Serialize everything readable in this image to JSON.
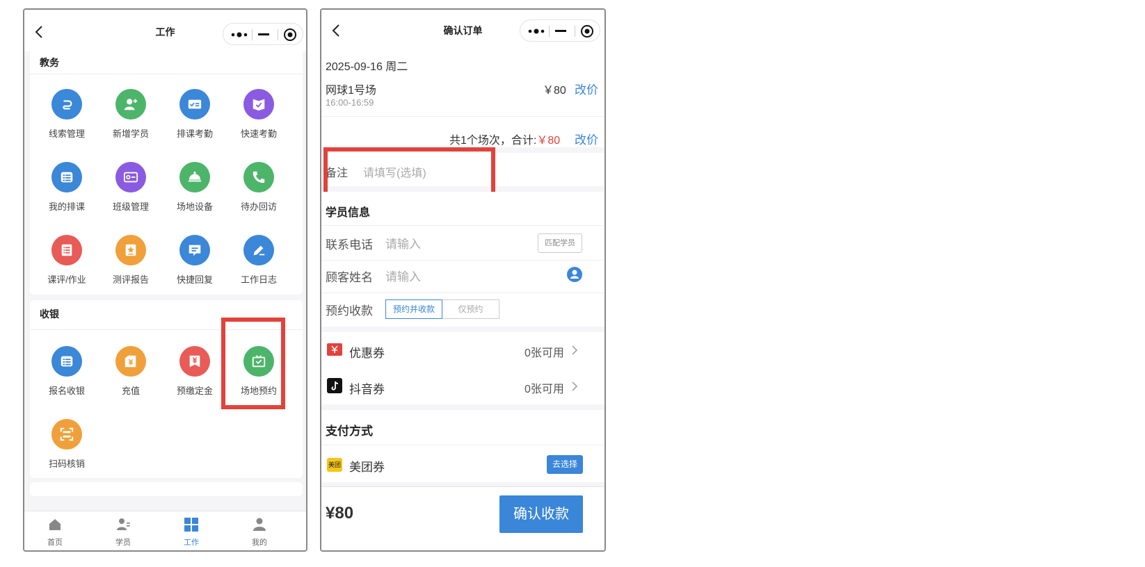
{
  "left_page": {
    "nav": {
      "title": "工作"
    },
    "sections": [
      {
        "title": "教务",
        "items": [
          {
            "label": "线索管理",
            "icon": "link-icon",
            "color": "#3b87d8"
          },
          {
            "label": "新增学员",
            "icon": "add-user-icon",
            "color": "#4cb569"
          },
          {
            "label": "排课考勤",
            "icon": "checklist-icon",
            "color": "#3b87d8"
          },
          {
            "label": "快速考勤",
            "icon": "check-book-icon",
            "color": "#8a5be0"
          },
          {
            "label": "我的排课",
            "icon": "list-icon",
            "color": "#3b87d8"
          },
          {
            "label": "班级管理",
            "icon": "id-card-icon",
            "color": "#8a5be0"
          },
          {
            "label": "场地设备",
            "icon": "bell-cover-icon",
            "color": "#4cb569"
          },
          {
            "label": "待办回访",
            "icon": "phone-call-icon",
            "color": "#4cb569"
          },
          {
            "label": "课评/作业",
            "icon": "document-list-icon",
            "color": "#e85b57"
          },
          {
            "label": "测评报告",
            "icon": "report-star-icon",
            "color": "#f0a03a"
          },
          {
            "label": "快捷回复",
            "icon": "message-icon",
            "color": "#3b87d8"
          },
          {
            "label": "工作日志",
            "icon": "pen-icon",
            "color": "#3b87d8"
          }
        ]
      },
      {
        "title": "收银",
        "items": [
          {
            "label": "报名收银",
            "icon": "list-icon",
            "color": "#3b87d8"
          },
          {
            "label": "充值",
            "icon": "wallet-yen-icon",
            "color": "#f0a03a"
          },
          {
            "label": "预缴定金",
            "icon": "yen-bag-icon",
            "color": "#e85b57"
          },
          {
            "label": "场地预约",
            "icon": "tv-check-icon",
            "color": "#4cb569"
          },
          {
            "label": "扫码核销",
            "icon": "scan-icon",
            "color": "#f0a03a"
          }
        ]
      }
    ],
    "tabs": [
      {
        "label": "首页",
        "icon": "home-icon"
      },
      {
        "label": "学员",
        "icon": "students-icon"
      },
      {
        "label": "工作",
        "icon": "grid-icon",
        "active": true
      },
      {
        "label": "我的",
        "icon": "person-icon"
      }
    ]
  },
  "right_page": {
    "nav": {
      "title": "确认订单"
    },
    "order": {
      "date": "2025-09-16 周二",
      "venue": "网球1号场",
      "time": "16:00-16:59",
      "price": "￥80",
      "edit_price": "改价",
      "summary_prefix": "共1个场次，合计:",
      "total": "￥80",
      "summary_edit": "改价"
    },
    "remark": {
      "label": "备注",
      "placeholder": "请填写(选填)"
    },
    "student_info": {
      "title": "学员信息",
      "phone_label": "联系电话",
      "phone_placeholder": "请输入",
      "match_button": "匹配学员",
      "name_label": "顾客姓名",
      "name_placeholder": "请输入",
      "payment_label": "预约收款",
      "option_active": "预约并收款",
      "option_inactive": "仅预约"
    },
    "coupons": [
      {
        "label": "优惠券",
        "value": "0张可用",
        "icon": "coupon-icon"
      },
      {
        "label": "抖音券",
        "value": "0张可用",
        "icon": "douyin-icon"
      }
    ],
    "payment": {
      "title": "支付方式",
      "method": "美团券",
      "choose": "去选择",
      "method_icon_text": "美团"
    },
    "footer": {
      "total": "¥80",
      "confirm": "确认收款"
    }
  }
}
